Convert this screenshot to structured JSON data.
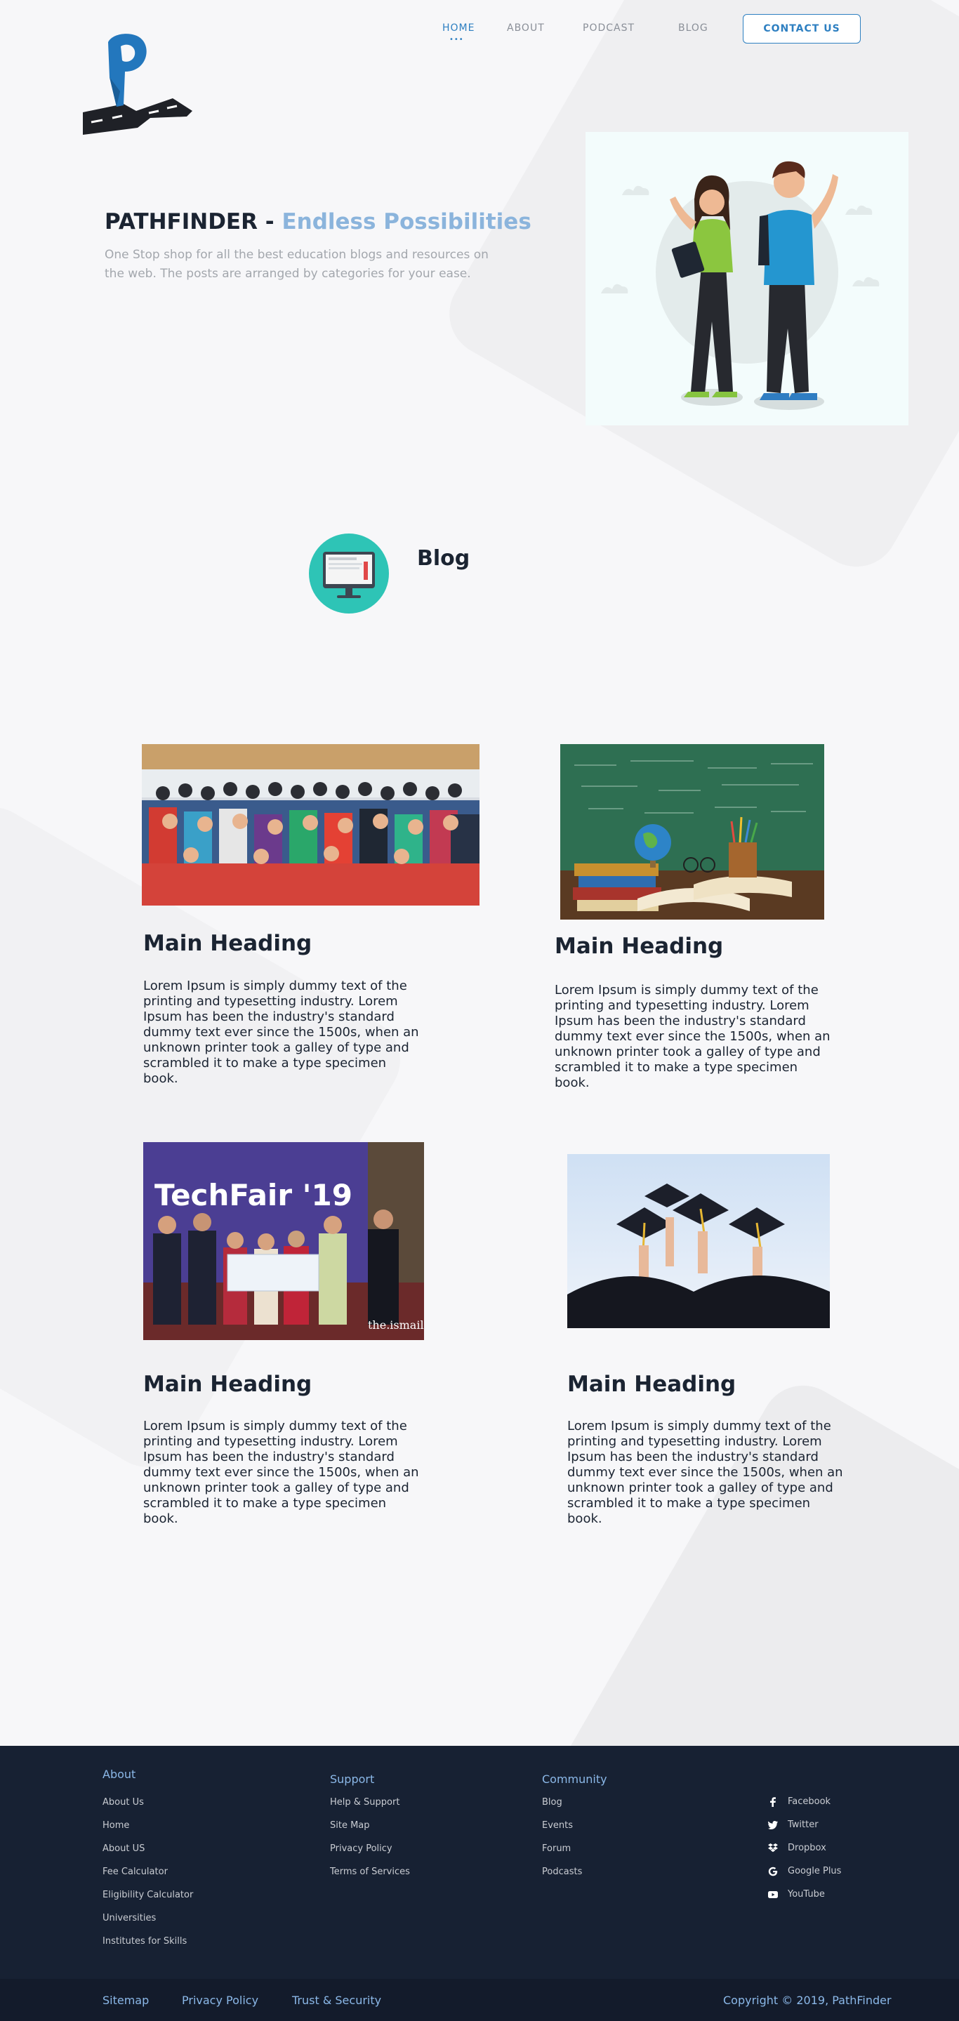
{
  "nav": {
    "items": [
      "HOME",
      "ABOUT",
      "PODCAST",
      "BLOG"
    ],
    "active_indicator": "•••",
    "contact_label": "CONTACT US"
  },
  "hero": {
    "title_main": "PATHFINDER -",
    "title_accent": "Endless Possibilities",
    "subtitle": "One Stop shop for all the best education blogs and resources on the web. The posts are arranged by categories for your ease."
  },
  "blog": {
    "section_title": "Blog",
    "cards": [
      {
        "heading": "Main Heading",
        "body": "Lorem Ipsum is simply dummy text of the printing and typesetting industry. Lorem Ipsum has been the industry's standard dummy text ever since the 1500s, when an unknown printer took a galley of type and scrambled it to make a type specimen book."
      },
      {
        "heading": "Main Heading",
        "body": "Lorem Ipsum is simply dummy text of the printing and typesetting industry. Lorem Ipsum has been the industry's standard dummy text ever since the 1500s, when an unknown printer took a galley of type and scrambled it to make a type specimen book."
      },
      {
        "heading": "Main Heading",
        "body": "Lorem Ipsum is simply dummy text of the printing and typesetting industry. Lorem Ipsum has been the industry's standard dummy text ever since the 1500s, when an unknown printer took a galley of type and scrambled it to make a type specimen book."
      },
      {
        "heading": "Main Heading",
        "body": "Lorem Ipsum is simply dummy text of the printing and typesetting industry. Lorem Ipsum has been the industry's standard dummy text ever since the 1500s, when an unknown printer took a galley of type and scrambled it to make a type specimen book."
      }
    ],
    "card3_image": {
      "banner_text": "TechFair '19",
      "watermark": "the.ismaili"
    }
  },
  "footer": {
    "about": {
      "heading": "About",
      "links": [
        "About Us",
        "Home",
        "About US",
        "Fee Calculator",
        "Eligibility Calculator",
        "Universities",
        "Institutes for Skills"
      ]
    },
    "support": {
      "heading": "Support",
      "links": [
        "Help & Support",
        "Site Map",
        "Privacy Policy",
        "Terms of Services"
      ]
    },
    "community": {
      "heading": "Community",
      "links": [
        "Blog",
        "Events",
        "Forum",
        "Podcasts"
      ]
    },
    "social": [
      {
        "label": "Facebook",
        "icon": "facebook-icon"
      },
      {
        "label": "Twitter",
        "icon": "twitter-icon"
      },
      {
        "label": "Dropbox",
        "icon": "dropbox-icon"
      },
      {
        "label": "Google Plus",
        "icon": "google-plus-icon"
      },
      {
        "label": "YouTube",
        "icon": "youtube-icon"
      }
    ],
    "bottom_links": [
      "Sitemap",
      "Privacy Policy",
      "Trust & Security"
    ],
    "copyright": "Copyright © 2019, PathFinder"
  },
  "colors": {
    "accent": "#2d7fc1",
    "accent_light": "#8bb4dc",
    "footer_bg": "#172133",
    "footer_bottom_bg": "#131b2b",
    "blog_icon_teal": "#2ec4b6"
  }
}
